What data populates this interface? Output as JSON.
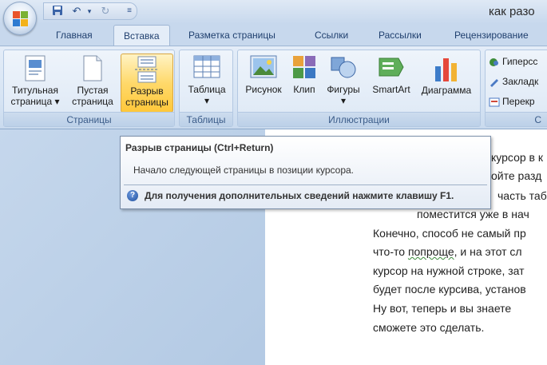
{
  "window": {
    "doc_title": "как разо"
  },
  "tabs": [
    {
      "label": "Главная"
    },
    {
      "label": "Вставка"
    },
    {
      "label": "Разметка страницы"
    },
    {
      "label": "Ссылки"
    },
    {
      "label": "Рассылки"
    },
    {
      "label": "Рецензирование"
    }
  ],
  "ribbon": {
    "pages_group": {
      "label": "Страницы",
      "title_page": {
        "line1": "Титульная",
        "line2": "страница ▾"
      },
      "blank_page": {
        "line1": "Пустая",
        "line2": "страница"
      },
      "page_break": {
        "line1": "Разрыв",
        "line2": "страницы"
      }
    },
    "tables_group": {
      "label": "Таблицы",
      "table": {
        "line1": "Таблица",
        "line2": "▾"
      }
    },
    "illustrations_group": {
      "label": "Иллюстрации",
      "picture": "Рисунок",
      "clip": "Клип",
      "shapes": {
        "line1": "Фигуры",
        "line2": "▾"
      },
      "smartart": "SmartArt",
      "chart": "Диаграмма"
    },
    "links_group": {
      "label": "С",
      "hyperlink": "Гиперсс",
      "bookmark": "Закладк",
      "crossref": "Перекр"
    }
  },
  "tooltip": {
    "title": "Разрыв страницы (Ctrl+Return)",
    "description": "Начало следующей страницы в позиции курсора.",
    "help_icon": "?",
    "help_text": "Для получения дополнительных сведений нажмите клавишу F1."
  },
  "document": {
    "lines": [
      "курсор в к",
      "ойте разд",
      "часть таб",
      "поместится уже в нач",
      "Конечно, способ не самый пр",
      "что-то ",
      "попроще",
      ", и на этот сл",
      "курсор на нужной строке, зат",
      "будет после курсива, установ",
      "Ну вот, теперь и вы знаете",
      "сможете это сделать."
    ]
  },
  "colors": {
    "accent": "#2a5699",
    "hot_button": "#ffd96b",
    "ribbon_bg": "#dde8f5"
  }
}
